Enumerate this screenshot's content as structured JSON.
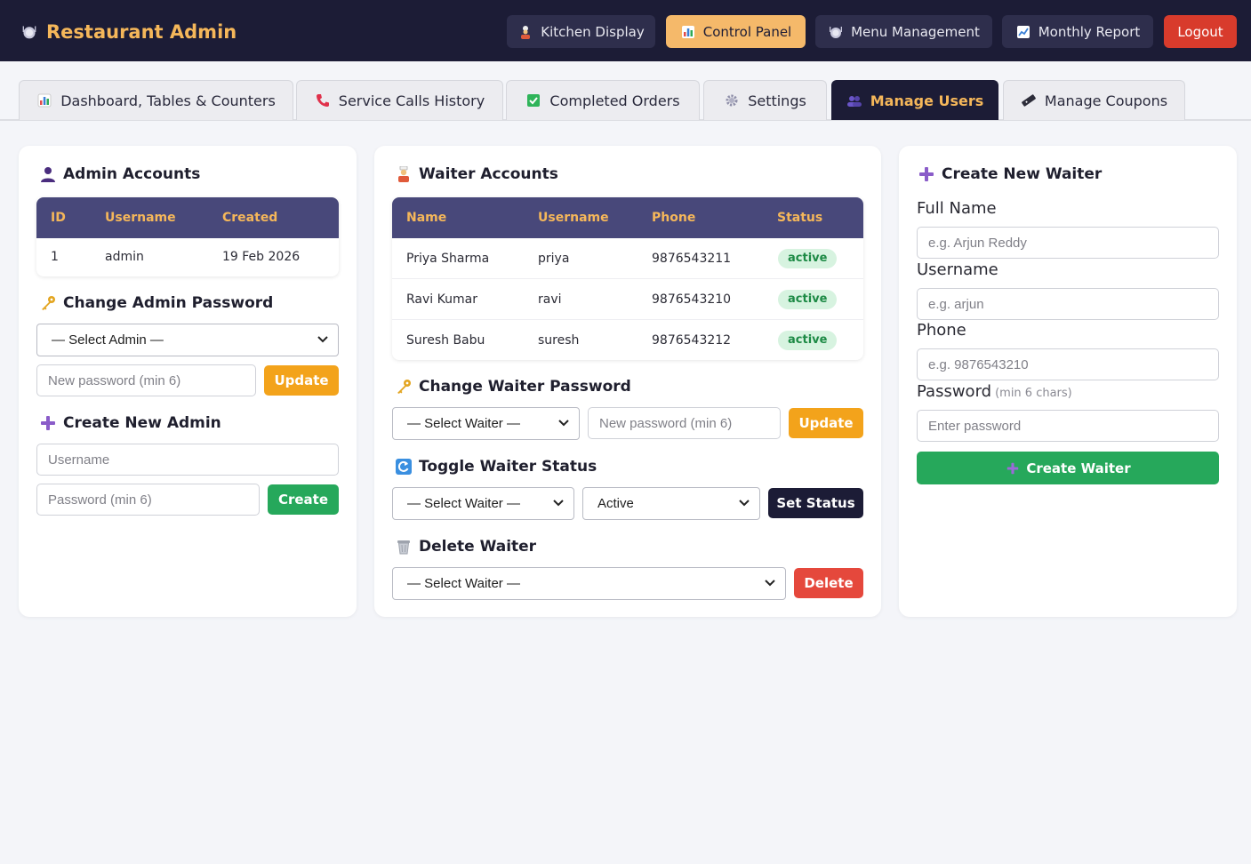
{
  "app": {
    "title": "Restaurant Admin",
    "logo_icon": "plate-icon"
  },
  "nav": {
    "kitchen": "Kitchen Display",
    "control": "Control Panel",
    "menu": "Menu Management",
    "report": "Monthly Report",
    "logout": "Logout"
  },
  "tabs": {
    "dashboard": "Dashboard, Tables & Counters",
    "service": "Service Calls History",
    "orders": "Completed Orders",
    "settings": "Settings",
    "users": "Manage Users",
    "coupons": "Manage Coupons"
  },
  "admins": {
    "title": "Admin Accounts",
    "columns": [
      "ID",
      "Username",
      "Created"
    ],
    "rows": [
      {
        "id": "1",
        "username": "admin",
        "created": "19 Feb 2026"
      }
    ],
    "change_password": {
      "title": "Change Admin Password",
      "select": "— Select Admin —",
      "password_placeholder": "New password (min 6)",
      "button": "Update"
    },
    "create": {
      "title": "Create New Admin",
      "username_placeholder": "Username",
      "password_placeholder": "Password (min 6)",
      "button": "Create"
    }
  },
  "waiters": {
    "title": "Waiter Accounts",
    "columns": [
      "Name",
      "Username",
      "Phone",
      "Status"
    ],
    "rows": [
      {
        "name": "Priya Sharma",
        "username": "priya",
        "phone": "9876543211",
        "status": "active"
      },
      {
        "name": "Ravi Kumar",
        "username": "ravi",
        "phone": "9876543210",
        "status": "active"
      },
      {
        "name": "Suresh Babu",
        "username": "suresh",
        "phone": "9876543212",
        "status": "active"
      }
    ],
    "change_password": {
      "title": "Change Waiter Password",
      "select": "— Select Waiter —",
      "password_placeholder": "New password (min 6)",
      "button": "Update"
    },
    "toggle": {
      "title": "Toggle Waiter Status",
      "select": "— Select Waiter —",
      "status": "Active",
      "button": "Set Status"
    },
    "delete": {
      "title": "Delete Waiter",
      "select": "— Select Waiter —",
      "button": "Delete"
    }
  },
  "create_waiter": {
    "title": "Create New Waiter",
    "full_name_label": "Full Name",
    "full_name_placeholder": "e.g. Arjun Reddy",
    "username_label": "Username",
    "username_placeholder": "e.g. arjun",
    "phone_label": "Phone",
    "phone_placeholder": "e.g. 9876543210",
    "password_label": "Password",
    "password_hint": "(min 6 chars)",
    "password_placeholder": "Enter password",
    "button": "Create Waiter"
  },
  "colors": {
    "header_bg": "#1c1c36",
    "accent": "#f5b75a",
    "table_head": "#48487a",
    "success": "#26a85b",
    "danger": "#e5483c",
    "warning": "#f3a31b"
  }
}
